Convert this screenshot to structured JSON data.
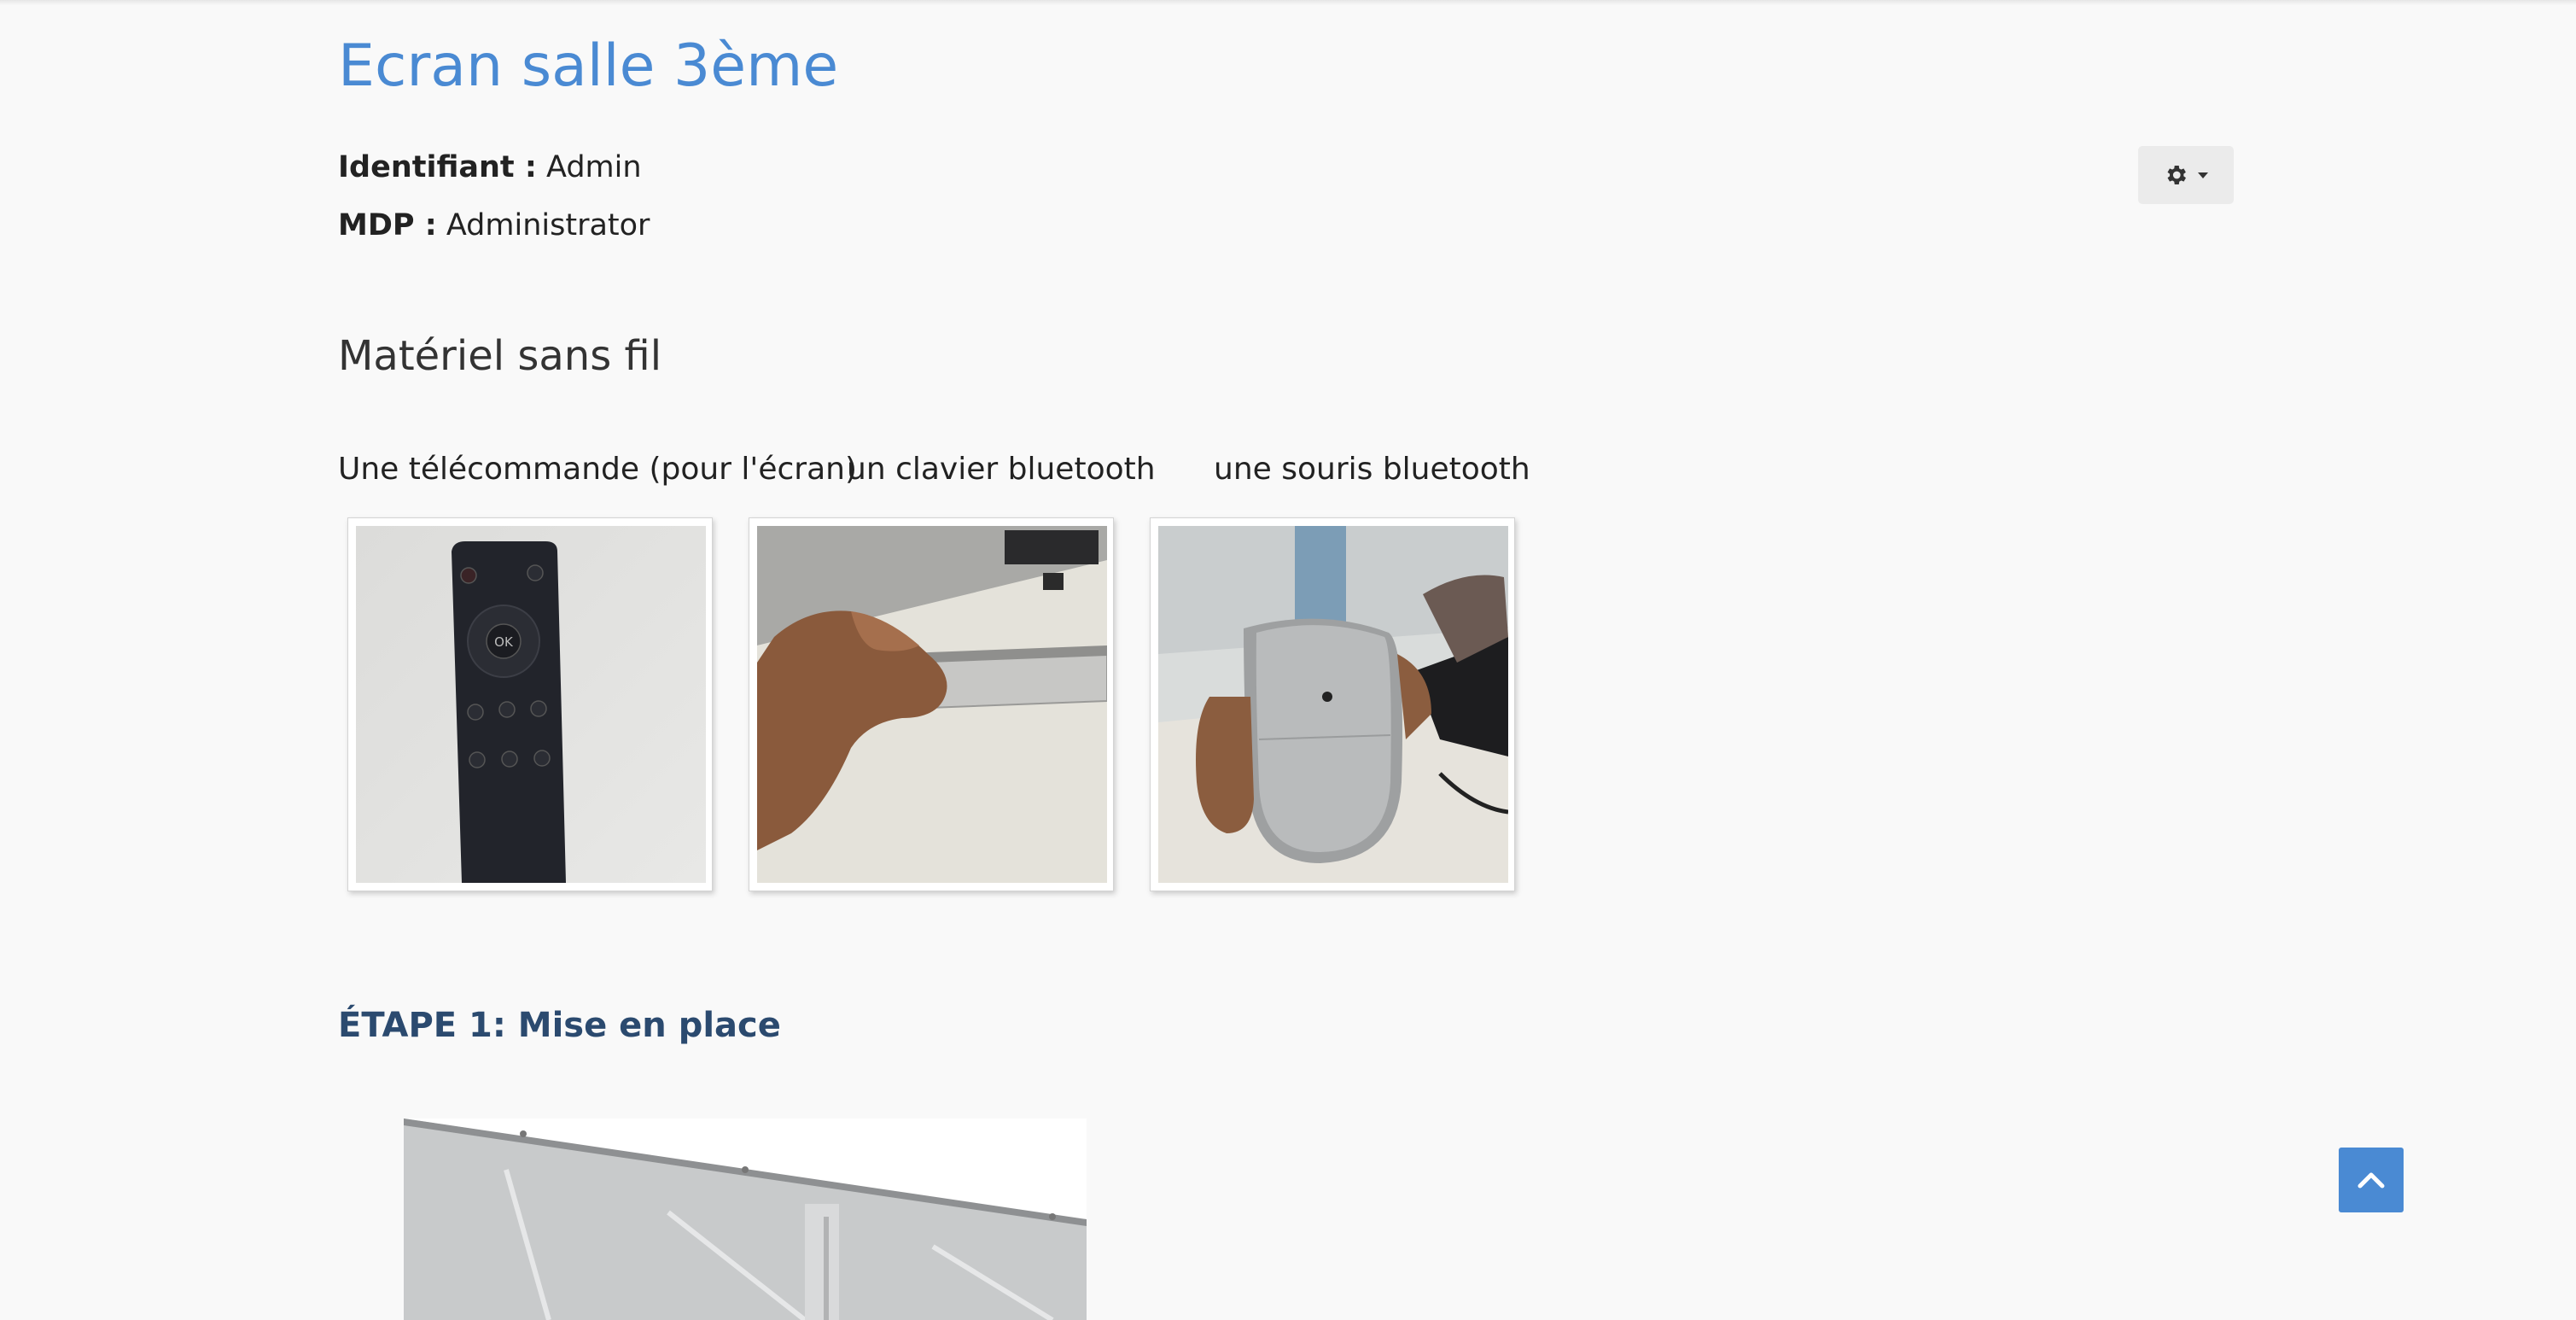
{
  "page": {
    "title": "Ecran salle 3ème"
  },
  "credentials": {
    "id_label": "Identifiant :",
    "id_value": "Admin",
    "pwd_label": "MDP :",
    "pwd_value": "Administrator"
  },
  "settings_menu": {
    "icon": "gear-icon",
    "caret_icon": "caret-down-icon"
  },
  "wireless_section": {
    "heading": "Matériel sans fil",
    "items": [
      {
        "caption": "Une télécommande (pour l'écran)",
        "image": "remote-control-photo"
      },
      {
        "caption": "un clavier bluetooth",
        "image": "bluetooth-keyboard-photo"
      },
      {
        "caption": "une souris bluetooth",
        "image": "bluetooth-mouse-photo"
      }
    ]
  },
  "step1": {
    "heading": "ÉTAPE 1: Mise en place",
    "image": "screen-setup-photo"
  },
  "scroll_top": {
    "icon": "chevron-up-icon"
  },
  "colors": {
    "accent": "#4a8ad3",
    "step_heading": "#2b4a6f",
    "background": "#f9f9f9"
  }
}
